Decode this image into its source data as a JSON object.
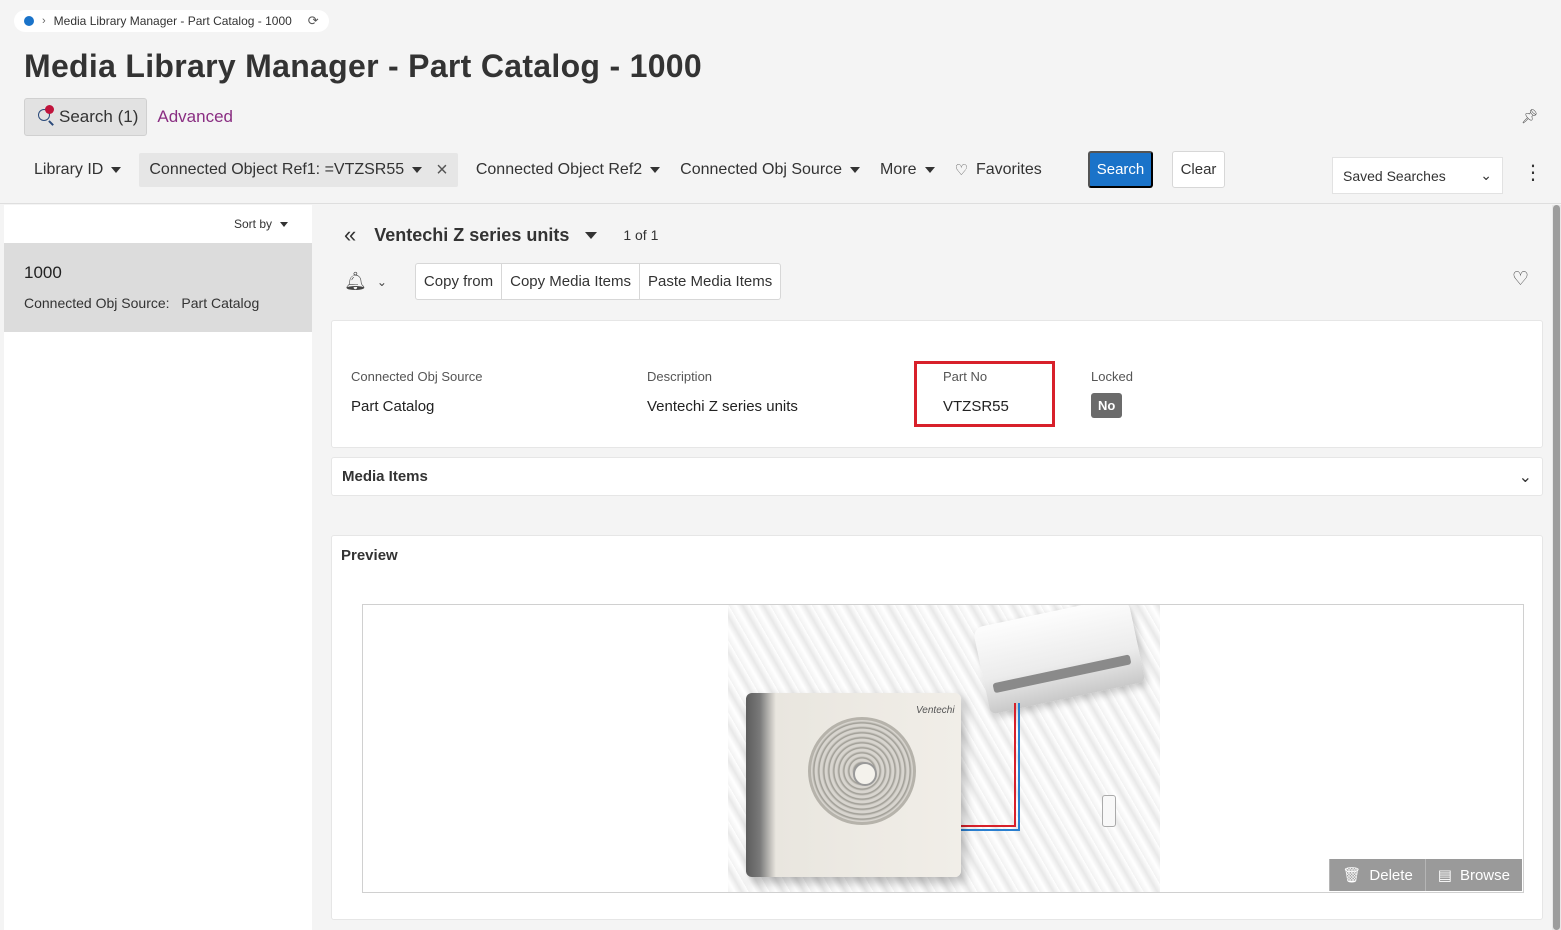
{
  "breadcrumb": {
    "text": "Media Library Manager - Part Catalog - 1000"
  },
  "page": {
    "title": "Media Library Manager - Part Catalog - 1000"
  },
  "search_tabs": {
    "search_label": "Search (1)",
    "advanced_label": "Advanced"
  },
  "filters": {
    "library_id": "Library ID",
    "connected_object_ref1": "Connected Object Ref1: =VTZSR55",
    "connected_object_ref2": "Connected Object Ref2",
    "connected_obj_source": "Connected Obj Source",
    "more": "More",
    "favorites": "Favorites",
    "search_button": "Search",
    "clear_button": "Clear",
    "saved_searches": "Saved Searches"
  },
  "list": {
    "sort_label": "Sort by",
    "items": [
      {
        "id": "1000",
        "source_label": "Connected Obj Source:",
        "source_value": "Part Catalog"
      }
    ]
  },
  "detail": {
    "title": "Ventechi Z series units",
    "pager": "1 of 1",
    "toolbar": {
      "copy_from": "Copy from",
      "copy_media_items": "Copy Media Items",
      "paste_media_items": "Paste Media Items"
    },
    "fields": {
      "connected_obj_source": {
        "label": "Connected Obj Source",
        "value": "Part Catalog"
      },
      "description": {
        "label": "Description",
        "value": "Ventechi Z series units"
      },
      "part_no": {
        "label": "Part No",
        "value": "VTZSR55"
      },
      "locked": {
        "label": "Locked",
        "value": "No"
      }
    },
    "media_items_heading": "Media Items",
    "preview_heading": "Preview",
    "preview_image": {
      "brand_text": "Ventechi"
    },
    "preview_actions": {
      "delete": "Delete",
      "browse": "Browse"
    }
  },
  "colors": {
    "accent": "#1a73c9",
    "highlight": "#d8202a",
    "advanced_link": "#8a2e82",
    "badge": "#6b6b6b"
  },
  "icons": [
    "status-dot-icon",
    "chevron-right-icon",
    "refresh-icon",
    "search-icon",
    "pin-icon",
    "caret-down-icon",
    "close-icon",
    "heart-icon",
    "chevron-down-icon",
    "kebab-menu-icon",
    "double-chevron-left-icon",
    "bell-icon",
    "trash-icon",
    "browse-icon"
  ]
}
